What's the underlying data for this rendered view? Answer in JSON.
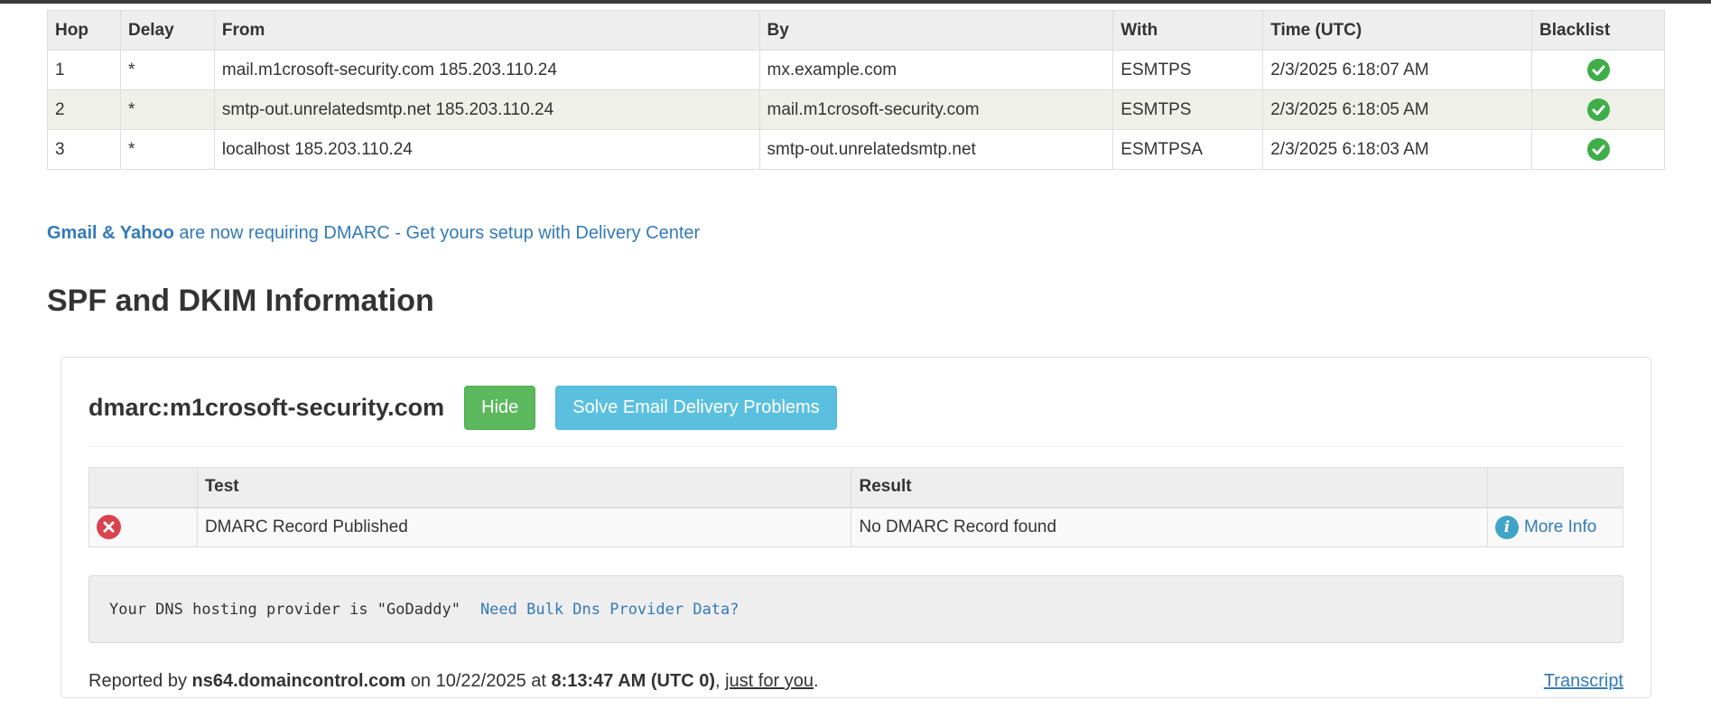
{
  "hops_table": {
    "headers": [
      "Hop",
      "Delay",
      "From",
      "By",
      "With",
      "Time (UTC)",
      "Blacklist"
    ],
    "rows": [
      {
        "hop": "1",
        "delay": "*",
        "from": "mail.m1crosoft-security.com 185.203.110.24",
        "by": "mx.example.com",
        "with": "ESMTPS",
        "time": "2/3/2025 6:18:07 AM",
        "blacklist": "check-circle-icon"
      },
      {
        "hop": "2",
        "delay": "*",
        "from": "smtp-out.unrelatedsmtp.net 185.203.110.24",
        "by": "mail.m1crosoft-security.com",
        "with": "ESMTPS",
        "time": "2/3/2025 6:18:05 AM",
        "blacklist": "check-circle-icon"
      },
      {
        "hop": "3",
        "delay": "*",
        "from": "localhost 185.203.110.24",
        "by": "smtp-out.unrelatedsmtp.net",
        "with": "ESMTPSA",
        "time": "2/3/2025 6:18:03 AM",
        "blacklist": "check-circle-icon"
      }
    ]
  },
  "promo": {
    "bold": "Gmail & Yahoo",
    "text": " are now requiring DMARC - Get yours setup with Delivery Center"
  },
  "section_title": "SPF and DKIM Information",
  "panel": {
    "title": "dmarc:m1crosoft-security.com",
    "hide_button": "Hide",
    "solve_button": "Solve Email Delivery Problems",
    "tests_table": {
      "headers": [
        "",
        "Test",
        "Result",
        ""
      ],
      "rows": [
        {
          "status_icon": "error-x-icon",
          "test": "DMARC Record Published",
          "result": "No DMARC Record found",
          "link": "More Info"
        }
      ]
    },
    "dns_box": {
      "text": "Your DNS hosting provider is \"GoDaddy\"",
      "link": "Need Bulk Dns Provider Data?"
    },
    "report": {
      "prefix": "Reported by ",
      "server": "ns64.domaincontrol.com",
      "on": " on 10/22/2025 at ",
      "time": "8:13:47 AM (UTC 0)",
      "comma": ", ",
      "link": "just for you",
      "end": "."
    },
    "transcript_link": "Transcript"
  },
  "colors": {
    "link": "#337ab7",
    "success": "#3fae49",
    "error": "#d9434e",
    "btn_green": "#5cb85c",
    "btn_info": "#5bc0de"
  }
}
